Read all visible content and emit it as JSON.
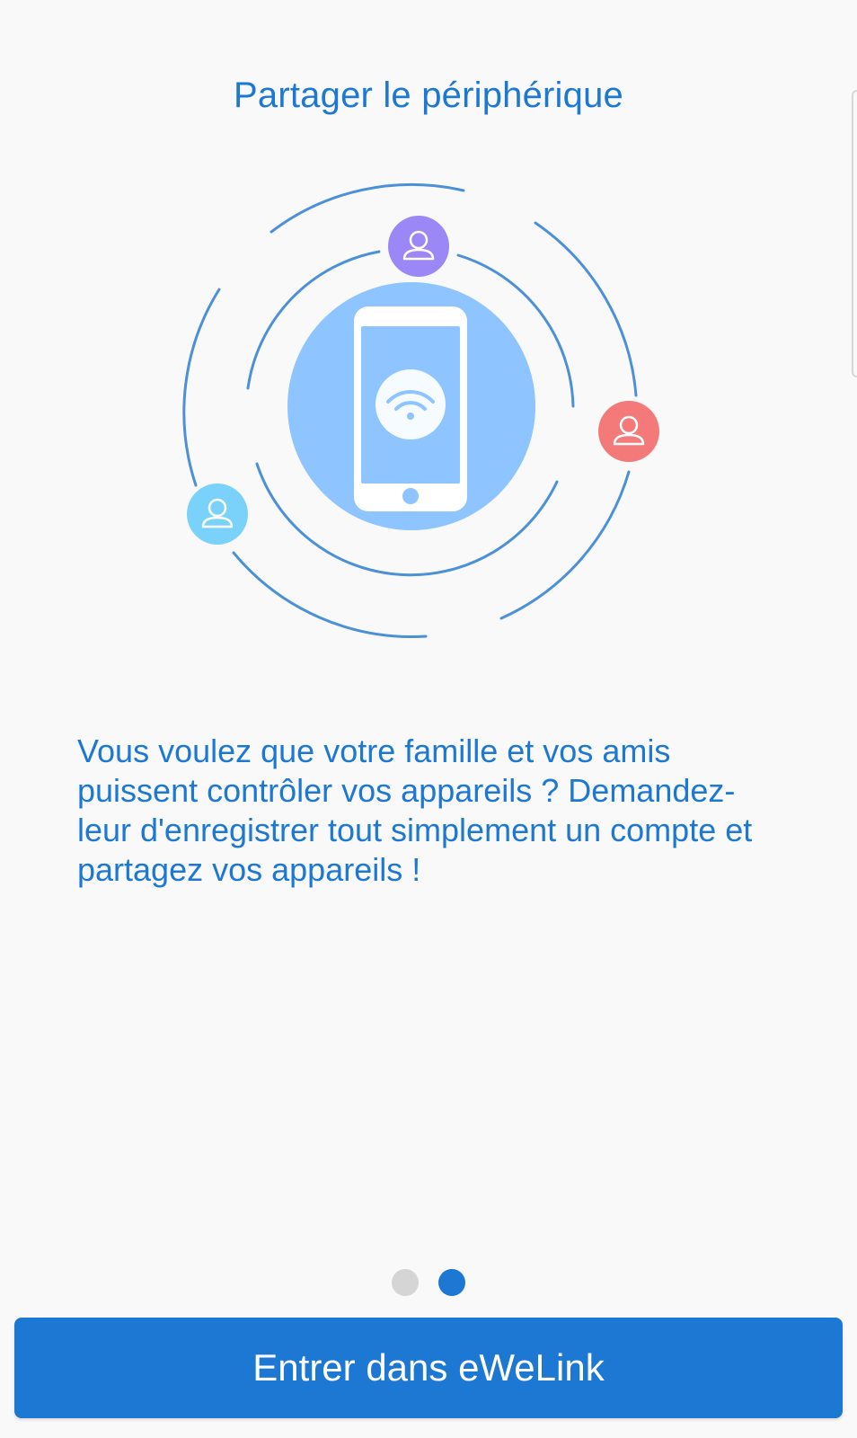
{
  "page": {
    "title": "Partager le périphérique",
    "description": "Vous voulez que votre famille et vos amis puissent contrôler vos appareils ? Demandez-leur d'enregistrer tout simplement un compte et partagez vos appareils !"
  },
  "illustration": {
    "center_icon": "smartphone-wifi-icon",
    "user_icons": [
      "user-icon",
      "user-icon",
      "user-icon"
    ],
    "colors": {
      "ring": "#4b90d8",
      "phone_disc": "#8ec4ff",
      "user_purple": "#9b87f5",
      "user_red": "#f47a7a",
      "user_cyan": "#7ad2fb"
    }
  },
  "pager": {
    "total": 2,
    "active_index": 1
  },
  "button": {
    "label": "Entrer dans eWeLink"
  },
  "colors": {
    "accent": "#1c78d3",
    "background": "#f9f9f9",
    "dot_inactive": "#d5d5d5"
  }
}
